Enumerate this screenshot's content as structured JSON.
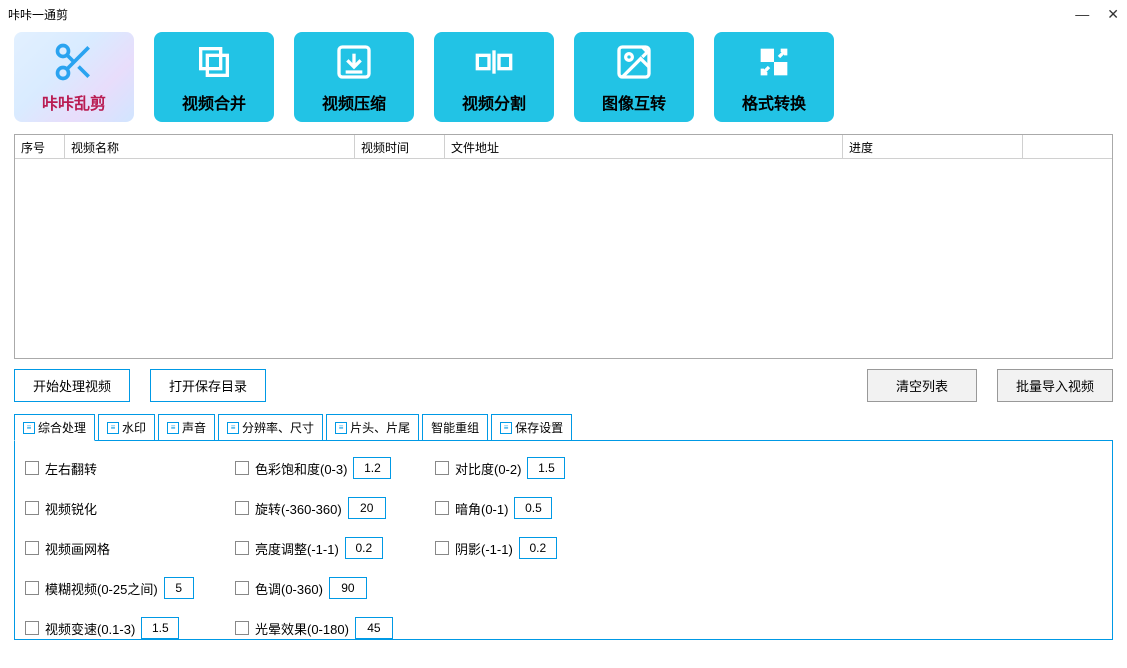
{
  "window": {
    "title": "咔咔一通剪"
  },
  "toolbar": {
    "items": [
      {
        "label": "咔咔乱剪"
      },
      {
        "label": "视频合并"
      },
      {
        "label": "视频压缩"
      },
      {
        "label": "视频分割"
      },
      {
        "label": "图像互转"
      },
      {
        "label": "格式转换"
      }
    ]
  },
  "list": {
    "columns": [
      "序号",
      "视频名称",
      "视频时间",
      "文件地址",
      "进度"
    ]
  },
  "actions": {
    "start": "开始处理视频",
    "open_dir": "打开保存目录",
    "clear": "清空列表",
    "import": "批量导入视频"
  },
  "tabs": [
    "综合处理",
    "水印",
    "声音",
    "分辨率、尺寸",
    "片头、片尾",
    "智能重组",
    "保存设置"
  ],
  "panel": {
    "flip": "左右翻转",
    "sharpen": "视频锐化",
    "grid": "视频画网格",
    "blur": "模糊视频(0-25之间)",
    "blur_val": "5",
    "speed": "视频变速(0.1-3)",
    "speed_val": "1.5",
    "saturation": "色彩饱和度(0-3)",
    "saturation_val": "1.2",
    "rotate": "旋转(-360-360)",
    "rotate_val": "20",
    "brightness": "亮度调整(-1-1)",
    "brightness_val": "0.2",
    "hue": "色调(0-360)",
    "hue_val": "90",
    "halo": "光晕效果(0-180)",
    "halo_val": "45",
    "contrast": "对比度(0-2)",
    "contrast_val": "1.5",
    "vignette": "暗角(0-1)",
    "vignette_val": "0.5",
    "shadow": "阴影(-1-1)",
    "shadow_val": "0.2"
  }
}
